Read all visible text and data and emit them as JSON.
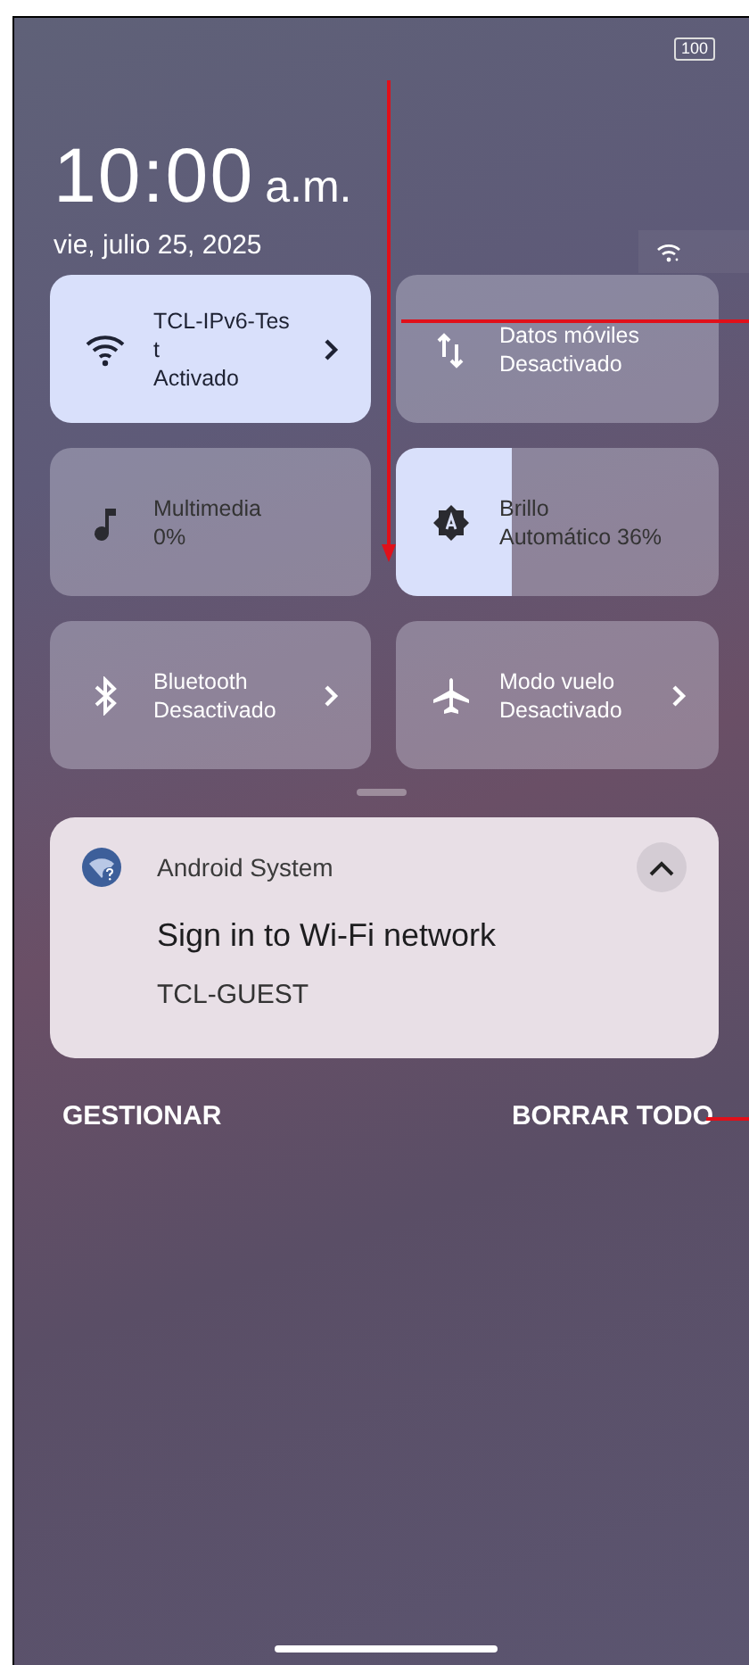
{
  "status_bar": {
    "battery": "100"
  },
  "header": {
    "time": "10:00",
    "ampm": "a.m.",
    "date": "vie, julio 25, 2025"
  },
  "tiles": [
    {
      "kind": "toggle",
      "title": "TCL-IPv6-Tes\nt",
      "subtitle": "Activado",
      "on": true,
      "chevron": true
    },
    {
      "kind": "toggle",
      "title": "Datos móviles",
      "subtitle": "Desactivado",
      "on": false,
      "chevron": false
    },
    {
      "kind": "slider",
      "title": "Multimedia",
      "subtitle": "0%",
      "level": 0
    },
    {
      "kind": "slider",
      "title": "Brillo",
      "subtitle": "Automático 36%",
      "level": 0.36
    },
    {
      "kind": "toggle",
      "title": "Bluetooth",
      "subtitle": "Desactivado",
      "on": false,
      "chevron": true
    },
    {
      "kind": "toggle",
      "title": "Modo vuelo",
      "subtitle": "Desactivado",
      "on": false,
      "chevron": true
    }
  ],
  "notification": {
    "app": "Android System",
    "title": "Sign in to Wi-Fi network",
    "text": "TCL-GUEST",
    "expanded": true
  },
  "actions": [
    "GESTIONAR",
    "BORRAR TODO"
  ],
  "annotations": [
    {
      "kind": "arrow-down"
    },
    {
      "kind": "line"
    },
    {
      "kind": "line"
    }
  ]
}
